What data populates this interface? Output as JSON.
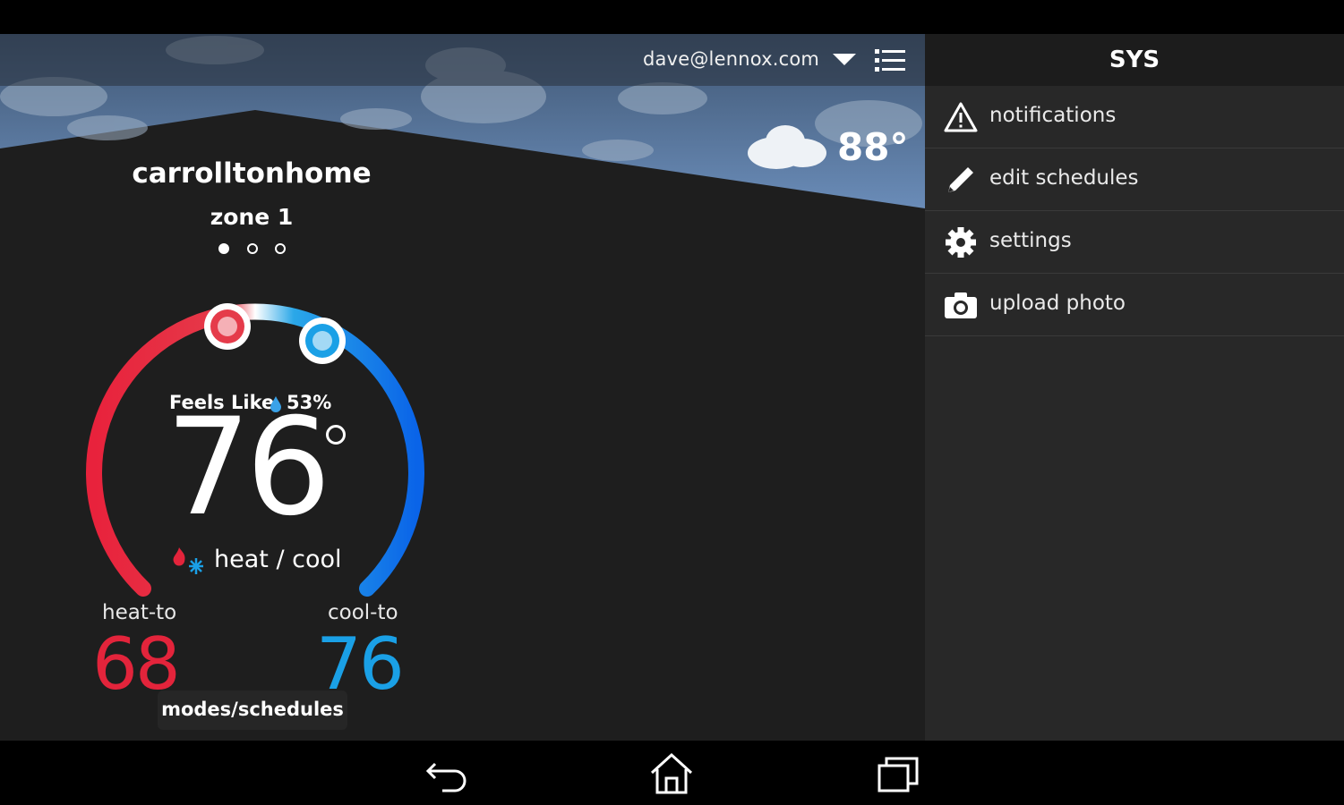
{
  "header": {
    "account_email": "dave@lennox.com"
  },
  "weather": {
    "outdoor_temp": "88°"
  },
  "home": {
    "name": "carrolltonhome",
    "zone": "zone 1",
    "zone_count": 3,
    "active_zone_index": 0
  },
  "thermostat": {
    "feels_like_label": "Feels Like",
    "humidity": "53%",
    "current_temp": "76",
    "mode": "heat / cool",
    "heat_to_label": "heat-to",
    "heat_to_value": "68",
    "cool_to_label": "cool-to",
    "cool_to_value": "76",
    "modes_button": "modes/schedules"
  },
  "side_panel": {
    "title": "SYS",
    "items": [
      {
        "label": "notifications",
        "icon": "warning-icon"
      },
      {
        "label": "edit schedules",
        "icon": "pencil-icon"
      },
      {
        "label": "settings",
        "icon": "gear-icon"
      },
      {
        "label": "upload photo",
        "icon": "camera-icon"
      }
    ]
  },
  "colors": {
    "heat": "#e3243b",
    "cool": "#1aa0e6",
    "sky": "#5a7aa3",
    "panel": "#282828",
    "main_bg": "#1e1e1e"
  },
  "navbar": {
    "buttons": [
      "back-icon",
      "home-icon",
      "recent-apps-icon"
    ]
  }
}
